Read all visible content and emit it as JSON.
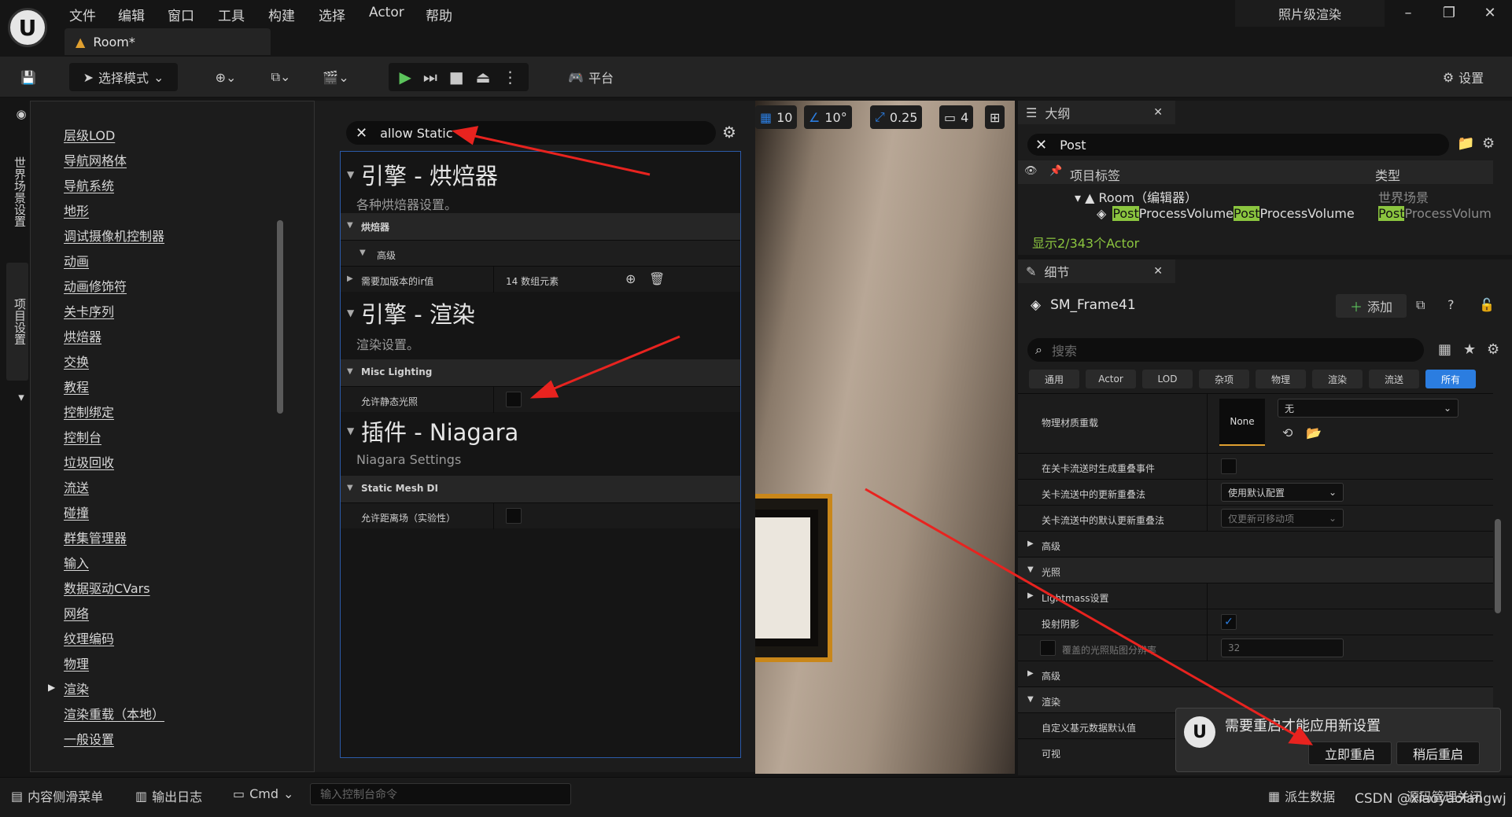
{
  "menu": [
    "文件",
    "编辑",
    "窗口",
    "工具",
    "构建",
    "选择",
    "Actor",
    "帮助"
  ],
  "doc_tab": "Room*",
  "window_title": "照片级渲染",
  "toolbar": {
    "mode": "选择模式",
    "platform": "平台",
    "settings": "设置"
  },
  "vertical_tabs": [
    "世界场景设置",
    "项目设置"
  ],
  "categories": [
    "层级LOD",
    "导航网格体",
    "导航系统",
    "地形",
    "调试摄像机控制器",
    "动画",
    "动画修饰符",
    "关卡序列",
    "烘焙器",
    "交换",
    "教程",
    "控制绑定",
    "控制台",
    "垃圾回收",
    "流送",
    "碰撞",
    "群集管理器",
    "输入",
    "数据驱动CVars",
    "网络",
    "纹理编码",
    "物理",
    "渲染",
    "渲染重载（本地）",
    "一般设置"
  ],
  "settings": {
    "search_value": "allow Static",
    "sections": [
      {
        "title": "引擎 - 烘焙器",
        "subtitle": "各种烘焙器设置。",
        "group": "烘焙器",
        "subgroup": "高级",
        "prop": "需要加版本的ir值",
        "prop_value": "14 数组元素"
      },
      {
        "title": "引擎 - 渲染",
        "subtitle": "渲染设置。",
        "group": "Misc Lighting",
        "prop": "允许静态光照"
      },
      {
        "title": "插件 - Niagara",
        "subtitle": "Niagara Settings",
        "group": "Static Mesh DI",
        "prop": "允许距离场（实验性）"
      }
    ]
  },
  "viewport": {
    "grid": "10",
    "angle": "10°",
    "scale": "0.25",
    "camera": "4"
  },
  "outliner": {
    "tab": "大纲",
    "search_value": "Post",
    "col_label": "项目标签",
    "col_type": "类型",
    "room": "Room（编辑器）",
    "room_type": "世界场景",
    "item_hl": "Post",
    "item_rest": "ProcessVolume",
    "type_hl": "Post",
    "type_rest": "ProcessVolum",
    "count": "显示2/343个Actor"
  },
  "details": {
    "tab": "细节",
    "object": "SM_Frame41",
    "add": "添加",
    "search_placeholder": "搜索",
    "filters": [
      "通用",
      "Actor",
      "LOD",
      "杂项",
      "物理",
      "渲染",
      "流送",
      "所有"
    ],
    "material_label": "物理材质重载",
    "material_none": "None",
    "material_dropdown": "无",
    "rows": [
      "在关卡流送时生成重叠事件",
      "关卡流送中的更新重叠法",
      "关卡流送中的默认更新重叠法",
      "高级",
      "光照",
      "Lightmass设置",
      "投射阴影",
      "覆盖的光照贴图分辨率",
      "高级",
      "渲染",
      "自定义基元数据默认值",
      "可视"
    ],
    "dd_update": "使用默认配置",
    "dd_default": "仅更新可移动项",
    "lightmap_res": "32"
  },
  "toast": {
    "message": "需要重启才能应用新设置",
    "restart_now": "立即重启",
    "restart_later": "稍后重启"
  },
  "status": {
    "content_drawer": "内容侧滑菜单",
    "output_log": "输出日志",
    "cmd": "Cmd",
    "console_placeholder": "输入控制台命令",
    "derived_data": "派生数据",
    "source_control": "源码管理关闭"
  },
  "watermark": "CSDN @xiaoyaolangwj",
  "colors": {
    "accent_blue": "#2b7de0",
    "highlight_green": "#8bc53f",
    "arrow_red": "#e8231f",
    "frame_orange": "#c9871a"
  }
}
